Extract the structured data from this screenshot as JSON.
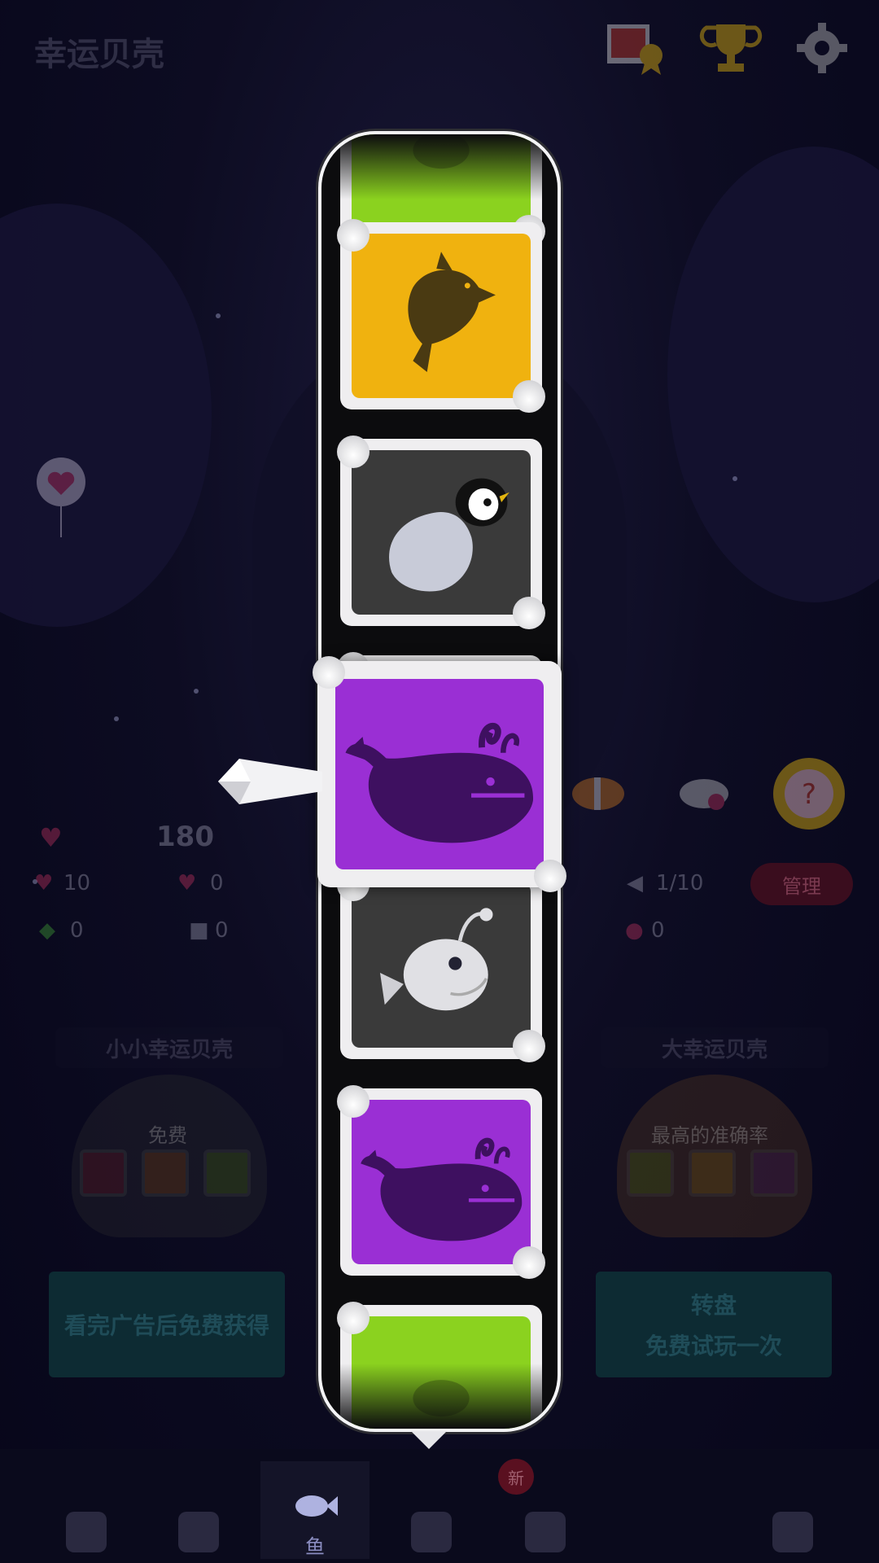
{
  "header": {
    "title": "幸运贝壳"
  },
  "stats": {
    "hearts": "180",
    "taps": "10",
    "bonus_hearts": "0",
    "leaves": "0",
    "shells": "0",
    "fish_count": "1/10",
    "other": "0"
  },
  "buttons": {
    "manage": "管理"
  },
  "panels": {
    "small": {
      "label": "小小幸运贝壳",
      "sub": "免费",
      "action": "看完广告后免费获得"
    },
    "big": {
      "label": "大幸运贝壳",
      "sub": "最高的准确率",
      "action_line1": "转盘",
      "action_line2": "免费试玩一次"
    }
  },
  "nav": {
    "items": [
      "",
      "",
      "鱼",
      "",
      "",
      ""
    ],
    "new_badge": "新"
  },
  "reel": {
    "tiles": [
      {
        "animal": "unknown",
        "color": "#8bd21f"
      },
      {
        "animal": "dolphin",
        "color": "#f0b20f"
      },
      {
        "animal": "penguin",
        "color": "#3a3a3a"
      },
      {
        "animal": "whale",
        "color": "#9a2fd4"
      },
      {
        "animal": "anglerfish",
        "color": "#3a3a3a"
      },
      {
        "animal": "whale",
        "color": "#9a2fd4"
      },
      {
        "animal": "unknown",
        "color": "#8bd21f"
      }
    ],
    "selected": "whale"
  }
}
